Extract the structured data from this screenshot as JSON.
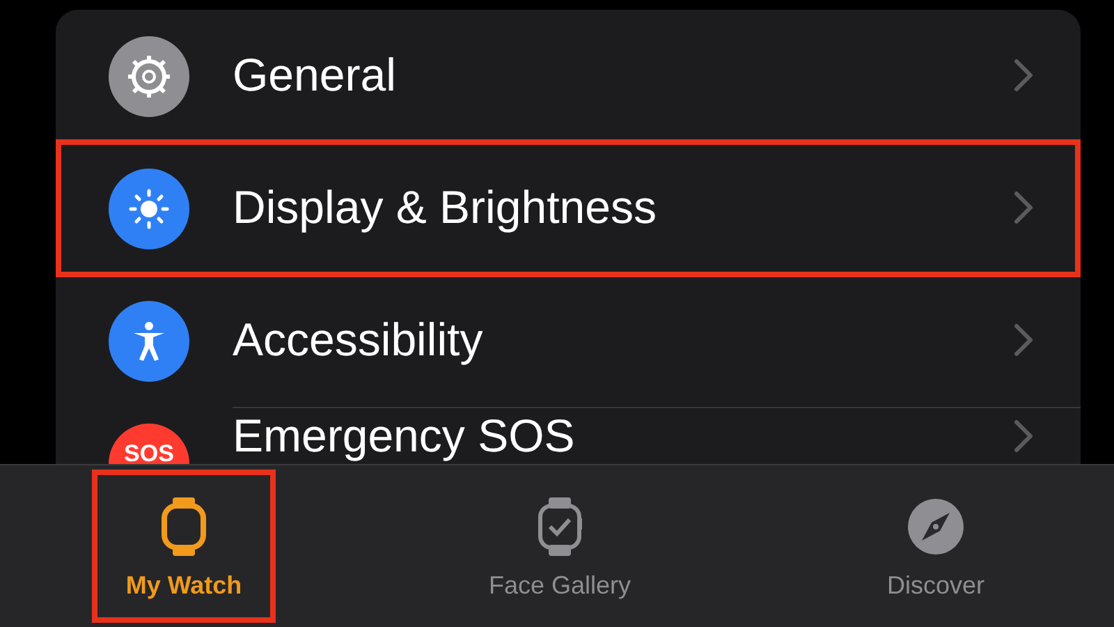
{
  "settings": [
    {
      "kind": "gear",
      "label": "General",
      "highlighted": false
    },
    {
      "kind": "sun",
      "label": "Display & Brightness",
      "highlighted": true
    },
    {
      "kind": "accessibility",
      "label": "Accessibility",
      "highlighted": false
    },
    {
      "kind": "sos",
      "label": "Emergency SOS",
      "icon_text": "SOS",
      "highlighted": false
    }
  ],
  "tab_bar": [
    {
      "kind": "my-watch",
      "label": "My Watch",
      "selected": true,
      "highlighted": true
    },
    {
      "kind": "face-gallery",
      "label": "Face Gallery",
      "selected": false,
      "highlighted": false
    },
    {
      "kind": "discover",
      "label": "Discover",
      "selected": false,
      "highlighted": false
    }
  ]
}
